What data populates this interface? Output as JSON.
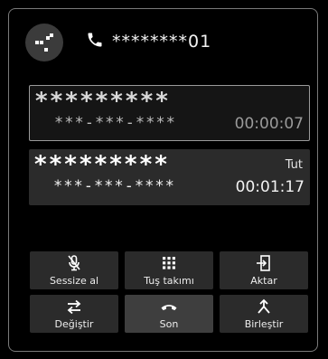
{
  "header": {
    "masked_number": "********01",
    "avatar_icon": "contact-avatar-icon",
    "phone_icon": "phone-icon"
  },
  "calls": [
    {
      "name": "*********",
      "number": "***-***-****",
      "timer": "00:00:07",
      "status": ""
    },
    {
      "name": "*********",
      "number": "***-***-****",
      "timer": "00:01:17",
      "status": "Tut"
    }
  ],
  "buttons": {
    "mute": {
      "label": "Sessize al",
      "icon": "mic-mute-icon"
    },
    "keypad": {
      "label": "Tuş takımı",
      "icon": "keypad-icon"
    },
    "transfer": {
      "label": "Aktar",
      "icon": "transfer-icon"
    },
    "swap": {
      "label": "Değiştir",
      "icon": "swap-arrows-icon"
    },
    "end": {
      "label": "Son",
      "icon": "hang-up-icon"
    },
    "merge": {
      "label": "Birleştir",
      "icon": "merge-calls-icon"
    }
  },
  "colors": {
    "background": "#000000",
    "panel_border": "#7a7a7a",
    "button_bg": "#2b2b2b",
    "text": "#f2f2f2"
  }
}
